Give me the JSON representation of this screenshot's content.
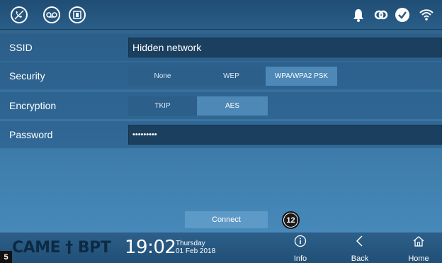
{
  "status_bar": {
    "left_icons": [
      "mute-call-icon",
      "voicemail-icon",
      "door-open-icon"
    ],
    "right_icons": [
      "bell-icon",
      "link-icon",
      "check-icon",
      "wifi-icon"
    ]
  },
  "form": {
    "ssid": {
      "label": "SSID",
      "value": "Hidden network"
    },
    "security": {
      "label": "Security",
      "options": [
        "None",
        "WEP",
        "WPA/WPA2 PSK"
      ],
      "selected": "WPA/WPA2 PSK"
    },
    "encryption": {
      "label": "Encryption",
      "options": [
        "TKIP",
        "AES"
      ],
      "selected": "AES"
    },
    "password": {
      "label": "Password",
      "value": "•••••••••"
    }
  },
  "connect_label": "Connect",
  "callout_number": "12",
  "footer": {
    "brand": "CAME † BPT",
    "time": "19:02",
    "day": "Thursday",
    "date": "01 Feb 2018",
    "nav": [
      {
        "label": "Info",
        "icon": "info-icon"
      },
      {
        "label": "Back",
        "icon": "back-icon"
      },
      {
        "label": "Home",
        "icon": "home-icon"
      }
    ]
  },
  "page_number": "5",
  "colors": {
    "background": "#3c7aa8",
    "field": "#1b3f5f",
    "selected_segment": "#4d88b6",
    "connect_button": "#5e9ac7"
  }
}
